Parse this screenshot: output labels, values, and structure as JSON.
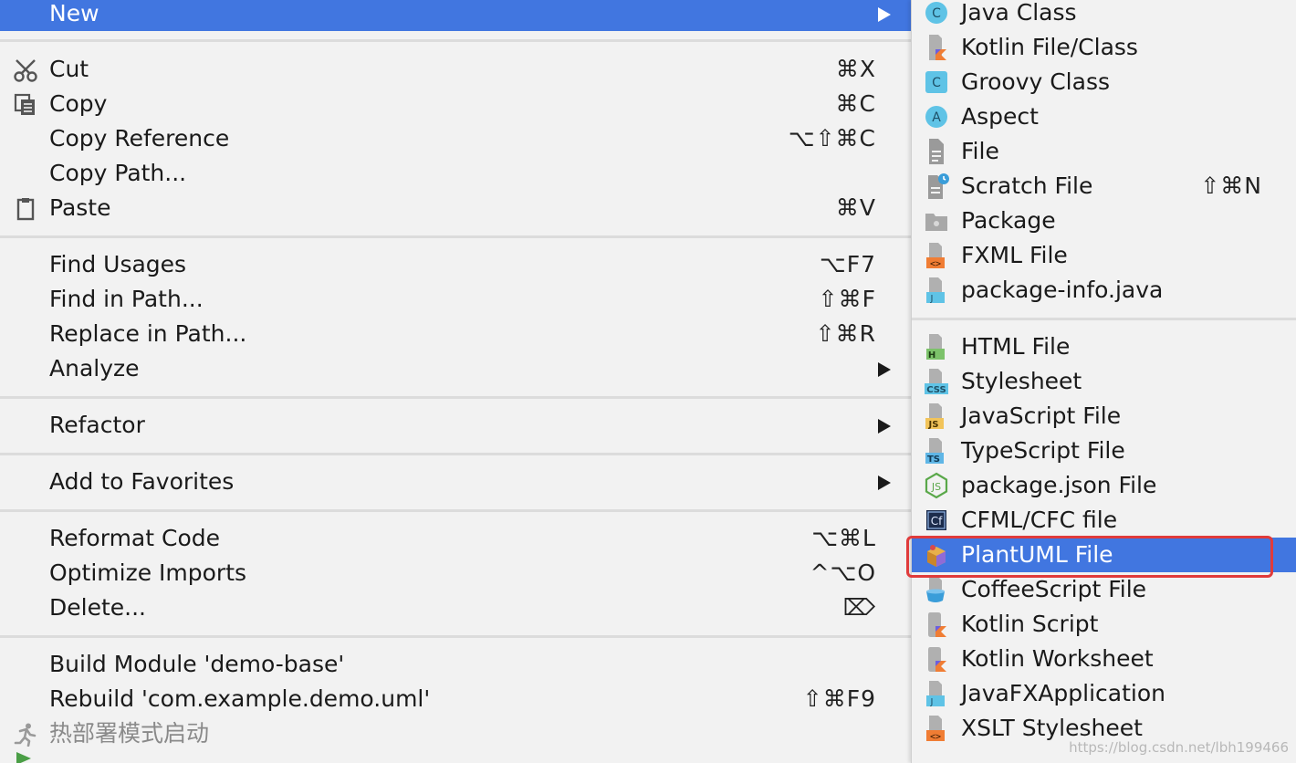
{
  "menu": {
    "new": {
      "label": "New"
    },
    "cut": {
      "label": "Cut",
      "shortcut": "⌘X",
      "icon": "scissors-icon"
    },
    "copy": {
      "label": "Copy",
      "shortcut": "⌘C",
      "icon": "copy-icon"
    },
    "copy_reference": {
      "label": "Copy Reference",
      "shortcut": "⌥⇧⌘C"
    },
    "copy_path": {
      "label": "Copy Path..."
    },
    "paste": {
      "label": "Paste",
      "shortcut": "⌘V",
      "icon": "clipboard-icon"
    },
    "find_usages": {
      "label": "Find Usages",
      "shortcut": "⌥F7"
    },
    "find_in_path": {
      "label": "Find in Path...",
      "shortcut": "⇧⌘F"
    },
    "replace_in_path": {
      "label": "Replace in Path...",
      "shortcut": "⇧⌘R"
    },
    "analyze": {
      "label": "Analyze"
    },
    "refactor": {
      "label": "Refactor"
    },
    "add_to_favorites": {
      "label": "Add to Favorites"
    },
    "reformat_code": {
      "label": "Reformat Code",
      "shortcut": "⌥⌘L"
    },
    "optimize_imports": {
      "label": "Optimize Imports",
      "shortcut": "^⌥O"
    },
    "delete": {
      "label": "Delete...",
      "shortcut": "⌦"
    },
    "build_module": {
      "label": "Build Module 'demo-base'"
    },
    "rebuild": {
      "label": "Rebuild 'com.example.demo.uml'",
      "shortcut": "⇧⌘F9"
    },
    "hot_deploy": {
      "label": "热部署模式启动",
      "icon": "running-man-icon"
    }
  },
  "submenu": {
    "java_class": {
      "label": "Java Class",
      "icon": "class-c-icon"
    },
    "kotlin_file": {
      "label": "Kotlin File/Class",
      "icon": "kotlin-file-icon"
    },
    "groovy_class": {
      "label": "Groovy Class",
      "icon": "groovy-class-icon"
    },
    "aspect": {
      "label": "Aspect",
      "icon": "aspect-a-icon"
    },
    "file": {
      "label": "File",
      "icon": "file-icon"
    },
    "scratch_file": {
      "label": "Scratch File",
      "shortcut": "⇧⌘N",
      "icon": "scratch-file-icon"
    },
    "package": {
      "label": "Package",
      "icon": "folder-icon"
    },
    "fxml_file": {
      "label": "FXML File",
      "icon": "fxml-file-icon"
    },
    "package_info": {
      "label": "package-info.java",
      "icon": "java-file-icon"
    },
    "html_file": {
      "label": "HTML File",
      "icon": "html-file-icon",
      "badge": "H"
    },
    "stylesheet": {
      "label": "Stylesheet",
      "icon": "css-file-icon",
      "badge": "CSS"
    },
    "javascript_file": {
      "label": "JavaScript File",
      "icon": "js-file-icon",
      "badge": "JS"
    },
    "typescript_file": {
      "label": "TypeScript File",
      "icon": "ts-file-icon",
      "badge": "TS"
    },
    "package_json": {
      "label": "package.json File",
      "icon": "nodejs-icon"
    },
    "cfml_file": {
      "label": "CFML/CFC file",
      "icon": "cfml-icon",
      "badge": "Cf"
    },
    "plantuml_file": {
      "label": "PlantUML File",
      "icon": "plantuml-icon"
    },
    "coffeescript_file": {
      "label": "CoffeeScript File",
      "icon": "coffee-cup-icon"
    },
    "kotlin_script": {
      "label": "Kotlin Script",
      "icon": "kotlin-script-icon"
    },
    "kotlin_worksheet": {
      "label": "Kotlin Worksheet",
      "icon": "kotlin-worksheet-icon"
    },
    "javafx_application": {
      "label": "JavaFXApplication",
      "icon": "java-file-icon"
    },
    "xslt_stylesheet": {
      "label": "XSLT Stylesheet",
      "icon": "xslt-file-icon"
    }
  },
  "watermark": "https://blog.csdn.net/lbh199466",
  "colors": {
    "highlight": "#4176e0",
    "callout": "#e03b3b",
    "background": "#f2f2f2"
  }
}
